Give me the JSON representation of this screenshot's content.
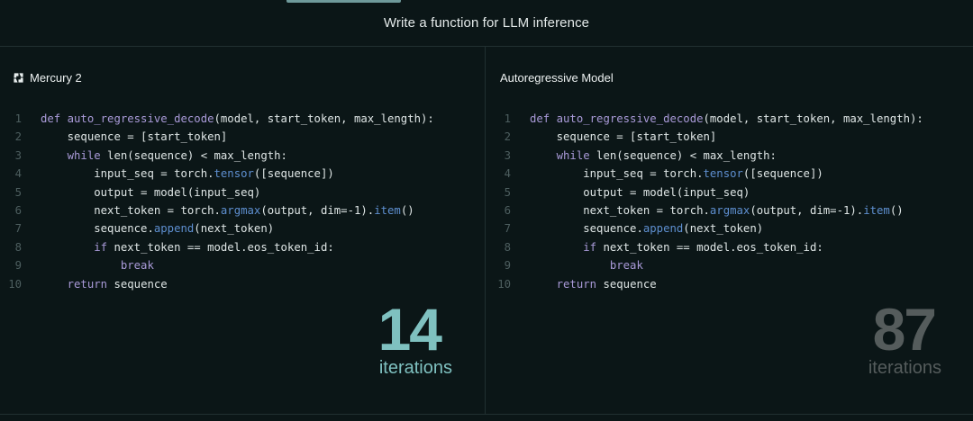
{
  "header": {
    "title": "Write a function for LLM inference"
  },
  "left": {
    "title": "Mercury 2",
    "count": "14",
    "count_label": "iterations"
  },
  "right": {
    "title": "Autoregressive Model",
    "count": "87",
    "count_label": "iterations"
  },
  "code_lines": [
    {
      "n": "1",
      "indent": "",
      "parts": [
        [
          "kw",
          "def "
        ],
        [
          "fn",
          "auto_regressive_decode"
        ],
        [
          "",
          "(model, start_token, max_length):"
        ]
      ]
    },
    {
      "n": "2",
      "indent": "    ",
      "parts": [
        [
          "",
          "sequence = [start_token]"
        ]
      ]
    },
    {
      "n": "3",
      "indent": "    ",
      "parts": [
        [
          "kw",
          "while "
        ],
        [
          "",
          "len(sequence) < max_length:"
        ]
      ]
    },
    {
      "n": "4",
      "indent": "        ",
      "parts": [
        [
          "",
          "input_seq = torch."
        ],
        [
          "at",
          "tensor"
        ],
        [
          "",
          "([sequence])"
        ]
      ]
    },
    {
      "n": "5",
      "indent": "        ",
      "parts": [
        [
          "",
          "output = model(input_seq)"
        ]
      ]
    },
    {
      "n": "6",
      "indent": "        ",
      "parts": [
        [
          "",
          "next_token = torch."
        ],
        [
          "at",
          "argmax"
        ],
        [
          "",
          "(output, dim=-1)."
        ],
        [
          "at",
          "item"
        ],
        [
          "",
          "()"
        ]
      ]
    },
    {
      "n": "7",
      "indent": "        ",
      "parts": [
        [
          "",
          "sequence."
        ],
        [
          "at",
          "append"
        ],
        [
          "",
          "(next_token)"
        ]
      ]
    },
    {
      "n": "8",
      "indent": "        ",
      "parts": [
        [
          "kw",
          "if "
        ],
        [
          "",
          "next_token == model.eos_token_id:"
        ]
      ]
    },
    {
      "n": "9",
      "indent": "            ",
      "parts": [
        [
          "kw",
          "break"
        ]
      ]
    },
    {
      "n": "10",
      "indent": "    ",
      "parts": [
        [
          "kw",
          "return "
        ],
        [
          "",
          "sequence"
        ]
      ]
    }
  ]
}
